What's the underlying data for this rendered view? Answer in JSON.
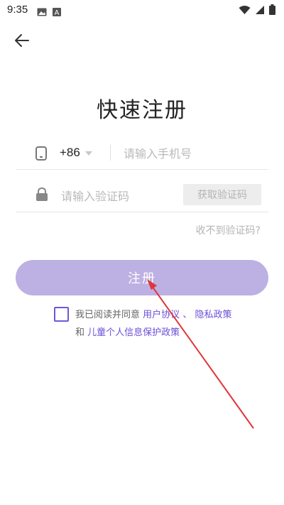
{
  "status_bar": {
    "time": "9:35",
    "icons_left": [
      "gallery-icon",
      "keyboard-a-icon"
    ],
    "icons_right": [
      "wifi-icon",
      "cellular-icon",
      "battery-icon"
    ]
  },
  "nav": {
    "back_icon": "arrow-left-icon"
  },
  "title": "快速注册",
  "phone": {
    "icon": "phone-icon",
    "country_code": "+86",
    "placeholder": "请输入手机号",
    "value": ""
  },
  "code": {
    "icon": "lock-icon",
    "placeholder": "请输入验证码",
    "value": "",
    "get_code_label": "获取验证码"
  },
  "no_code_link": "收不到验证码?",
  "register_label": "注册",
  "agreement": {
    "checked": false,
    "prefix": "我已阅读并同意",
    "user_agreement": "用户协议",
    "separator": "、",
    "privacy_policy": "隐私政策",
    "and": "和",
    "child_policy": "儿童个人信息保护政策"
  },
  "colors": {
    "accent": "#6a4fd6",
    "register_button": "#bdb0e3",
    "annotation_arrow": "#e0353b"
  }
}
